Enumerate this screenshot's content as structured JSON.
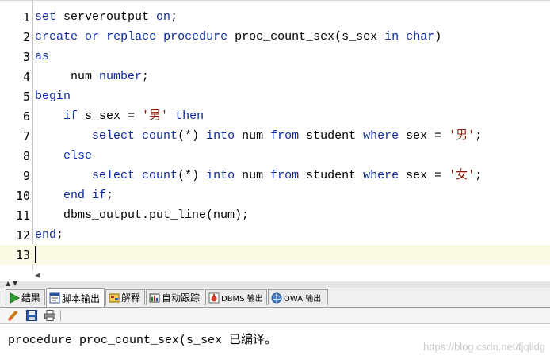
{
  "editor": {
    "lines": [
      {
        "num": "1",
        "tokens": [
          {
            "t": "set",
            "k": "kw"
          },
          {
            "t": " serveroutput "
          },
          {
            "t": "on",
            "k": "kw"
          },
          {
            "t": ";"
          }
        ]
      },
      {
        "num": "2",
        "tokens": [
          {
            "t": "create",
            "k": "kw"
          },
          {
            "t": " "
          },
          {
            "t": "or",
            "k": "kw"
          },
          {
            "t": " "
          },
          {
            "t": "replace",
            "k": "kw"
          },
          {
            "t": " "
          },
          {
            "t": "procedure",
            "k": "kw"
          },
          {
            "t": " proc_count_sex(s_sex "
          },
          {
            "t": "in",
            "k": "kw"
          },
          {
            "t": " "
          },
          {
            "t": "char",
            "k": "kw"
          },
          {
            "t": ")"
          }
        ]
      },
      {
        "num": "3",
        "tokens": [
          {
            "t": "as",
            "k": "kw"
          }
        ]
      },
      {
        "num": "4",
        "tokens": [
          {
            "t": "     num "
          },
          {
            "t": "number",
            "k": "kw"
          },
          {
            "t": ";"
          }
        ]
      },
      {
        "num": "5",
        "tokens": [
          {
            "t": "begin",
            "k": "kw"
          }
        ]
      },
      {
        "num": "6",
        "tokens": [
          {
            "t": "    "
          },
          {
            "t": "if",
            "k": "kw"
          },
          {
            "t": " s_sex = "
          },
          {
            "t": "'男'",
            "k": "str"
          },
          {
            "t": " "
          },
          {
            "t": "then",
            "k": "kw"
          }
        ]
      },
      {
        "num": "7",
        "tokens": [
          {
            "t": "        "
          },
          {
            "t": "select",
            "k": "kw"
          },
          {
            "t": " "
          },
          {
            "t": "count",
            "k": "kw"
          },
          {
            "t": "(*) "
          },
          {
            "t": "into",
            "k": "kw"
          },
          {
            "t": " num "
          },
          {
            "t": "from",
            "k": "kw"
          },
          {
            "t": " student "
          },
          {
            "t": "where",
            "k": "kw"
          },
          {
            "t": " sex = "
          },
          {
            "t": "'男'",
            "k": "str"
          },
          {
            "t": ";"
          }
        ]
      },
      {
        "num": "8",
        "tokens": [
          {
            "t": "    "
          },
          {
            "t": "else",
            "k": "kw"
          }
        ]
      },
      {
        "num": "9",
        "tokens": [
          {
            "t": "        "
          },
          {
            "t": "select",
            "k": "kw"
          },
          {
            "t": " "
          },
          {
            "t": "count",
            "k": "kw"
          },
          {
            "t": "(*) "
          },
          {
            "t": "into",
            "k": "kw"
          },
          {
            "t": " num "
          },
          {
            "t": "from",
            "k": "kw"
          },
          {
            "t": " student "
          },
          {
            "t": "where",
            "k": "kw"
          },
          {
            "t": " sex = "
          },
          {
            "t": "'女'",
            "k": "str"
          },
          {
            "t": ";"
          }
        ]
      },
      {
        "num": "10",
        "tokens": [
          {
            "t": "    "
          },
          {
            "t": "end",
            "k": "kw"
          },
          {
            "t": " "
          },
          {
            "t": "if",
            "k": "kw"
          },
          {
            "t": ";"
          }
        ]
      },
      {
        "num": "11",
        "tokens": [
          {
            "t": "    dbms_output.put_line(num);"
          }
        ]
      },
      {
        "num": "12",
        "tokens": [
          {
            "t": "end",
            "k": "kw"
          },
          {
            "t": ";"
          }
        ]
      },
      {
        "num": "13",
        "tokens": []
      }
    ],
    "current_line": "13"
  },
  "tabs": [
    {
      "label": "结果",
      "icon": "play-icon",
      "active": false
    },
    {
      "label": "脚本输出",
      "icon": "script-output-icon",
      "active": true
    },
    {
      "label": "解释",
      "icon": "explain-icon",
      "active": false
    },
    {
      "label": "自动跟踪",
      "icon": "autotrace-icon",
      "active": false
    },
    {
      "label": "DBMS 输出",
      "icon": "dbms-output-icon",
      "active": false
    },
    {
      "label": "OWA 输出",
      "icon": "owa-output-icon",
      "active": false
    }
  ],
  "toolbar": {
    "buttons": [
      {
        "name": "clear-icon"
      },
      {
        "name": "save-icon"
      },
      {
        "name": "print-icon"
      }
    ]
  },
  "output": {
    "text": "procedure proc_count_sex(s_sex 已编译。"
  },
  "watermark": "https://blog.csdn.net/fjqlldg",
  "colors": {
    "keyword": "#0c2aa0",
    "string": "#8a1f11",
    "current_line": "#fafae4"
  }
}
